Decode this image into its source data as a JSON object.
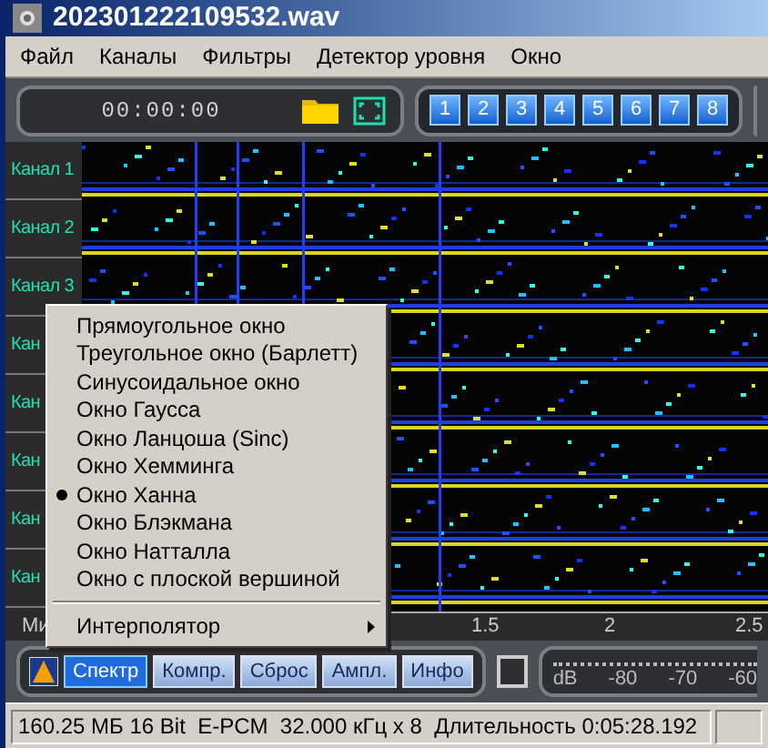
{
  "window": {
    "title": "202301222109532.wav"
  },
  "menu_bar": [
    "Файл",
    "Каналы",
    "Фильтры",
    "Детектор уровня",
    "Окно"
  ],
  "toolbar": {
    "time": "00:00:00",
    "channel_buttons": [
      "1",
      "2",
      "3",
      "4",
      "5",
      "6",
      "7",
      "8"
    ]
  },
  "channels": [
    "Канал 1",
    "Канал 2",
    "Канал 3",
    "Кан",
    "Кан",
    "Кан",
    "Кан",
    "Кан"
  ],
  "time_axis": {
    "left_label": "Ми",
    "ticks": [
      "1.5",
      "2",
      "2.5"
    ]
  },
  "view_tabs": [
    {
      "label": "Спектр",
      "selected": true
    },
    {
      "label": "Компр.",
      "selected": false
    },
    {
      "label": "Сброс",
      "selected": false
    },
    {
      "label": "Ампл.",
      "selected": false
    },
    {
      "label": "Инфо",
      "selected": false
    }
  ],
  "level_meter": {
    "unit": "dB",
    "ticks": [
      "-80",
      "-70",
      "-60"
    ]
  },
  "status_bar": [
    "160.25 МБ 16 Bit  E-PCM  32.000 кГц x 8  Длительность 0:05:28.192"
  ],
  "context_menu": {
    "items": [
      {
        "label": "Прямоугольное окно",
        "selected": false
      },
      {
        "label": "Треугольное окно (Барлетт)",
        "selected": false
      },
      {
        "label": "Синусоидальное окно",
        "selected": false
      },
      {
        "label": "Окно Гаусса",
        "selected": false
      },
      {
        "label": "Окно Ланцоша (Sinc)",
        "selected": false
      },
      {
        "label": "Окно Хемминга",
        "selected": false
      },
      {
        "label": "Окно Ханна",
        "selected": true
      },
      {
        "label": "Окно Блэкмана",
        "selected": false
      },
      {
        "label": "Окно Натталла",
        "selected": false
      },
      {
        "label": "Окно с плоской вершиной",
        "selected": false
      }
    ],
    "submenus": [
      "Интерполятор"
    ]
  }
}
